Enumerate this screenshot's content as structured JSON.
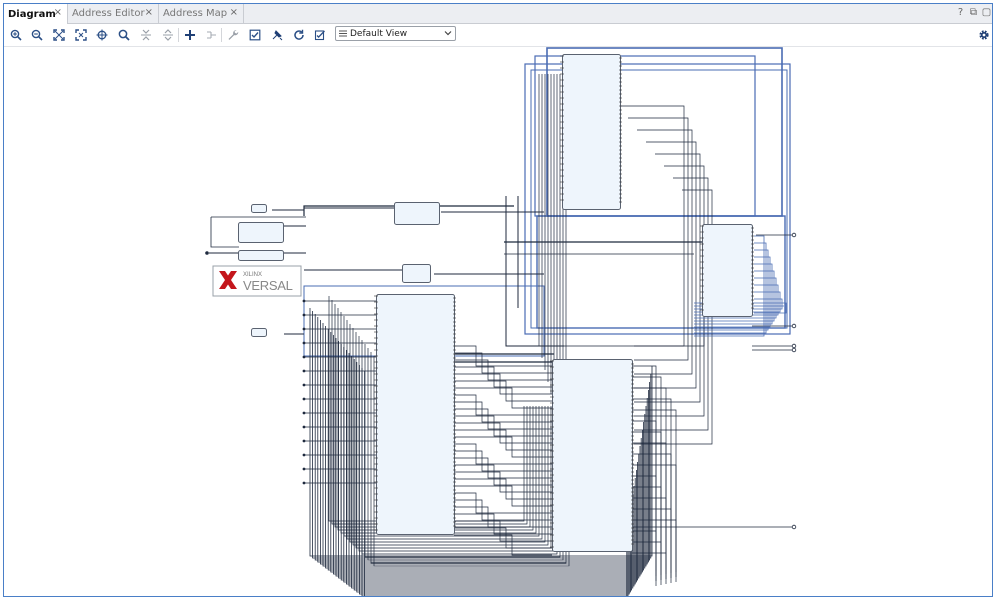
{
  "tabs": [
    {
      "label": "Diagram",
      "active": true
    },
    {
      "label": "Address Editor",
      "active": false
    },
    {
      "label": "Address Map",
      "active": false
    }
  ],
  "tab_close_glyph": "×",
  "window_controls": [
    "?",
    "⧉",
    "▢"
  ],
  "toolbar": {
    "view_select": {
      "value": "Default View"
    },
    "icons": [
      "zoom-in-icon",
      "zoom-out-icon",
      "zoom-fit-icon",
      "zoom-area-icon",
      "center-icon",
      "search-icon",
      "collapse-icon",
      "expand-icon",
      "add-ip-icon",
      "connect-icon",
      "wrench-icon",
      "validate-icon",
      "autoroute-icon",
      "refresh-icon",
      "report-icon",
      "settings-icon"
    ]
  },
  "diagram": {
    "logo": {
      "brand": "XILINX",
      "product": "VERSAL"
    },
    "colors": {
      "wire": "#1f2a3e",
      "bus": "#4a6cb3",
      "block_fill": "#eef5fc",
      "block_stroke": "#5a6270",
      "accent": "#4a7fc7"
    }
  }
}
